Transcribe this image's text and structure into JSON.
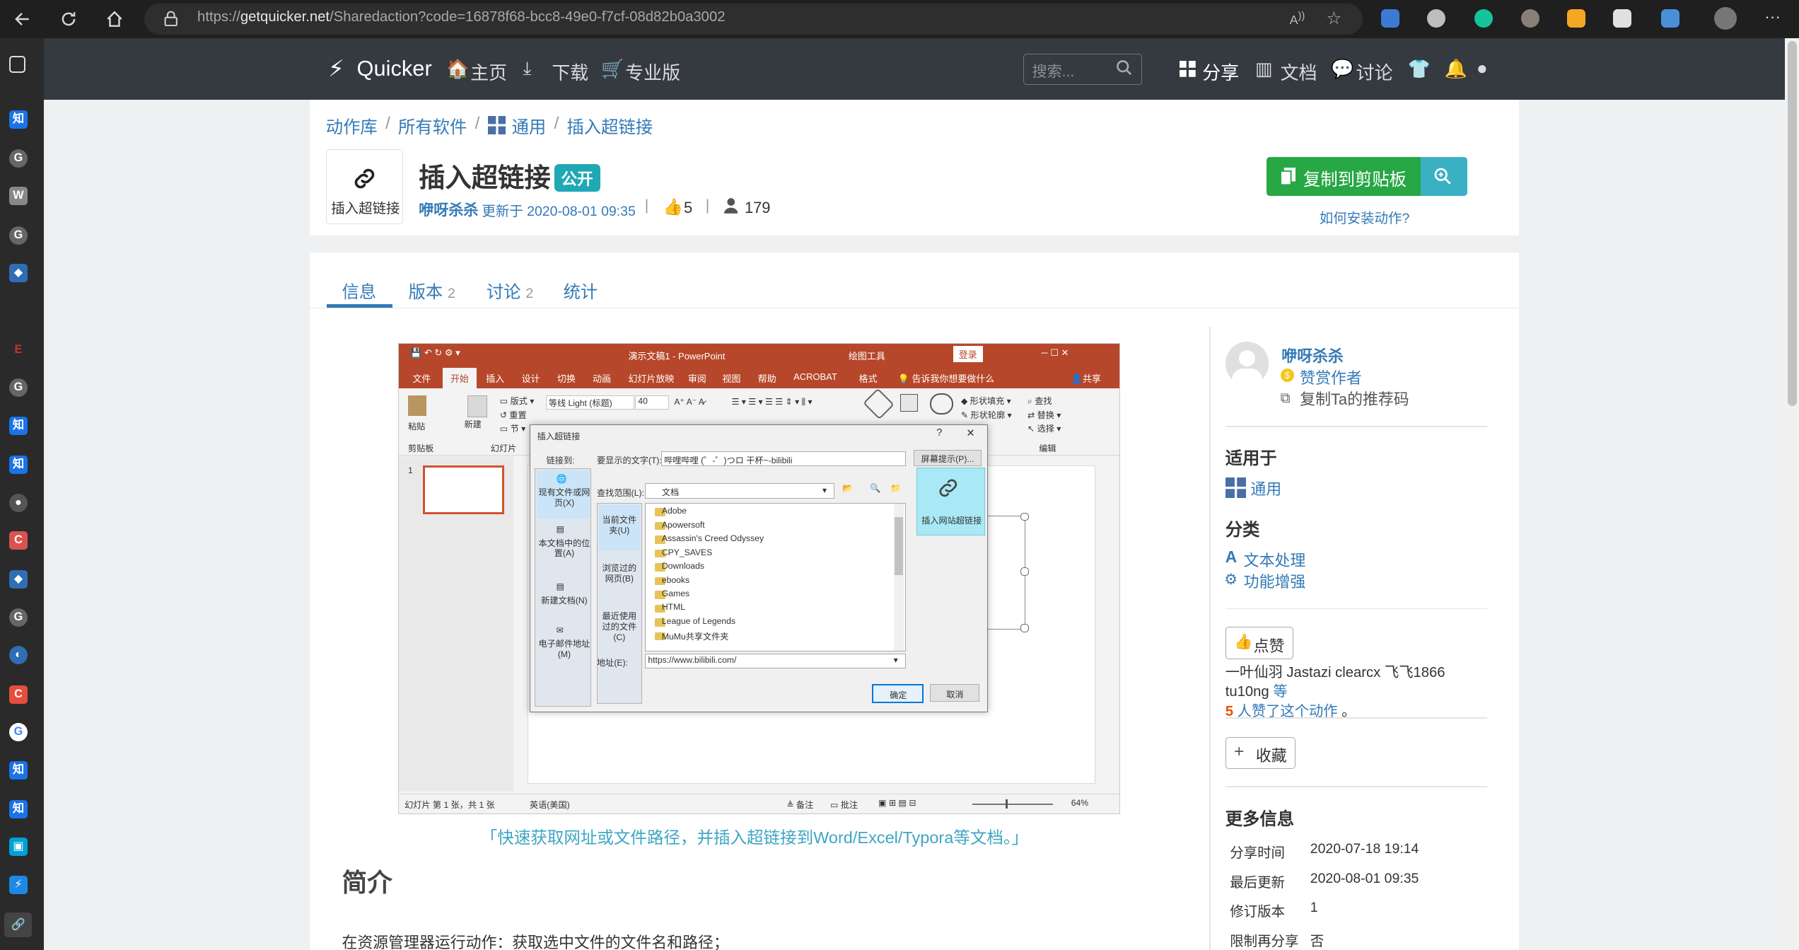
{
  "browser": {
    "url_prefix": "https://",
    "url_host": "getquicker.net",
    "url_path": "/Sharedaction?code=16878f68-bcc8-49e0-f7cf-08d82b0a3002"
  },
  "header": {
    "brand": "Quicker",
    "nav": [
      "主页",
      "下载",
      "专业版"
    ],
    "search_placeholder": "搜索...",
    "right_nav": [
      "分享",
      "文档",
      "讨论"
    ]
  },
  "breadcrumb": [
    "动作库",
    "所有软件",
    "通用",
    "插入超链接"
  ],
  "action": {
    "icon_label": "插入超链接",
    "title": "插入超链接",
    "badge": "公开",
    "author": "咿呀杀杀",
    "updated": "更新于 2020-08-01 09:35",
    "likes": "5",
    "users": "179",
    "copy_button": "复制到剪贴板",
    "install_help": "如何安装动作?"
  },
  "tabs": [
    {
      "label": "信息",
      "count": ""
    },
    {
      "label": "版本",
      "count": "2"
    },
    {
      "label": "讨论",
      "count": "2"
    },
    {
      "label": "统计",
      "count": ""
    }
  ],
  "screenshot": {
    "window_title": "演示文稿1 - PowerPoint",
    "drawing_tools": "绘图工具",
    "login": "登录",
    "ribbon_tabs": [
      "文件",
      "开始",
      "插入",
      "设计",
      "切换",
      "动画",
      "幻灯片放映",
      "审阅",
      "视图",
      "帮助",
      "ACROBAT",
      "格式"
    ],
    "tell_me": "告诉我你想要做什么",
    "share": "共享",
    "font": "等线 Light (标题)",
    "font_size": "40",
    "dialog_title": "插入超链接",
    "link_to": "链接到:",
    "display_text_label": "要显示的文字(T):",
    "display_text": "哔哩哔哩 (゜-゜)つロ 干杯~-bilibili",
    "screen_tip": "屏幕提示(P)...",
    "look_in_label": "查找范围(L):",
    "look_in": "文档",
    "left_items": [
      "现有文件或网页(X)",
      "本文档中的位置(A)",
      "新建文档(N)",
      "电子邮件地址(M)"
    ],
    "mid_items": [
      "当前文件夹(U)",
      "浏览过的网页(B)",
      "最近使用过的文件(C)"
    ],
    "folders": [
      "Adobe",
      "Apowersoft",
      "Assassin's Creed Odyssey",
      "CPY_SAVES",
      "Downloads",
      "ebooks",
      "Games",
      "HTML",
      "League of Legends",
      "MuMu共享文件夹"
    ],
    "address_label": "地址(E):",
    "address": "https://www.bilibili.com/",
    "ok": "确定",
    "cancel": "取消",
    "popup": "插入网站超链接",
    "status_left": "幻灯片 第 1 张，共 1 张",
    "status_lang": "英语(美国)",
    "notes": "备注",
    "comments": "批注",
    "zoom": "64%"
  },
  "caption": "「快速获取网址或文件路径，并插入超链接到Word/Excel/Typora等文档。」",
  "intro": {
    "heading": "简介",
    "text": "在资源管理器运行动作：获取选中文件的文件名和路径；"
  },
  "sidebar_right": {
    "author": "咿呀杀杀",
    "sponsor": "赞赏作者",
    "copy_code": "复制Ta的推荐码",
    "applies_heading": "适用于",
    "applies": "通用",
    "category_heading": "分类",
    "categories": [
      "文本处理",
      "功能增强"
    ],
    "like_button": "点赞",
    "likers": "一叶仙羽 Jastazi clearcx 飞飞1866 tu10ng",
    "likers_more": "等",
    "likers_count": "5",
    "likers_suffix": "人赞了这个动作",
    "fav_button": "收藏",
    "more_heading": "更多信息",
    "info_rows": [
      {
        "k": "分享时间",
        "v": "2020-07-18 19:14"
      },
      {
        "k": "最后更新",
        "v": "2020-08-01 09:35"
      },
      {
        "k": "修订版本",
        "v": "1"
      },
      {
        "k": "限制再分享",
        "v": "否"
      }
    ]
  },
  "colors": {
    "accent": "#337ab7",
    "header_bg": "#343a40",
    "green": "#28a745",
    "teal": "#3ab0c3",
    "ppt_red": "#b7472a"
  }
}
